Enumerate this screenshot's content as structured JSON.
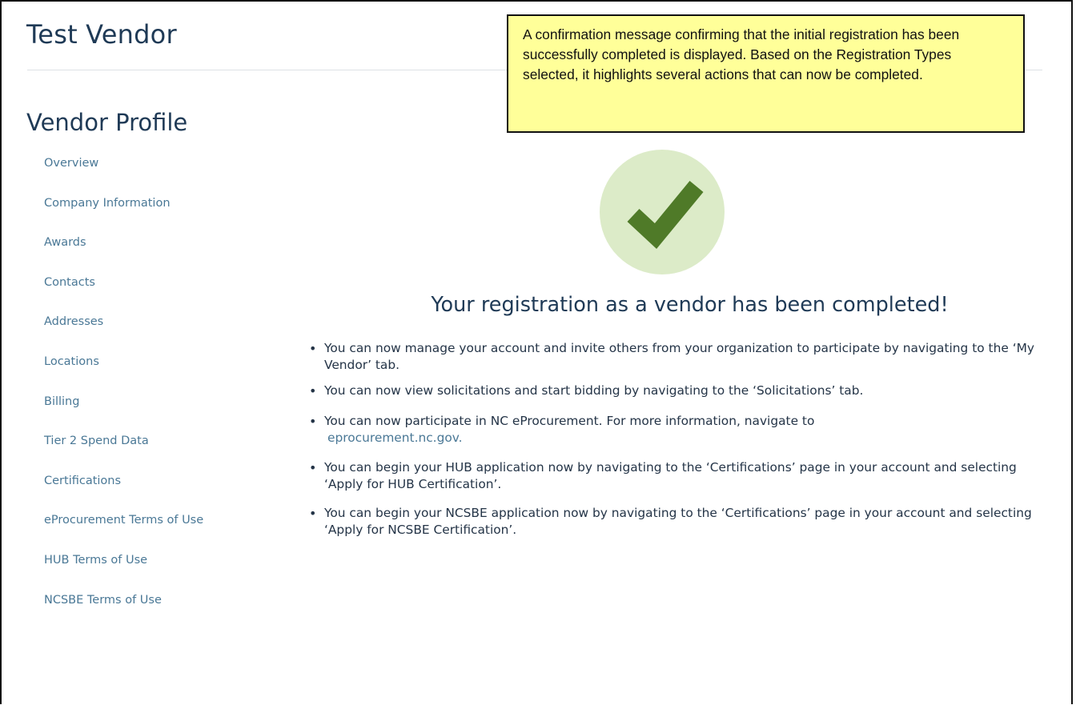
{
  "header": {
    "vendor_name": "Test Vendor"
  },
  "sidebar": {
    "heading": "Vendor Profile",
    "items": [
      {
        "label": "Overview"
      },
      {
        "label": "Company Information"
      },
      {
        "label": "Awards"
      },
      {
        "label": "Contacts"
      },
      {
        "label": "Addresses"
      },
      {
        "label": "Locations"
      },
      {
        "label": "Billing"
      },
      {
        "label": "Tier 2 Spend Data"
      },
      {
        "label": "Certifications"
      },
      {
        "label": "eProcurement Terms of Use"
      },
      {
        "label": "HUB Terms of Use"
      },
      {
        "label": "NCSBE Terms of Use"
      }
    ]
  },
  "callout": {
    "text": "A confirmation message confirming that the initial registration has been successfully completed is displayed. Based on the Registration Types selected, it highlights several actions that can now be completed."
  },
  "confirmation": {
    "icon": "checkmark-icon",
    "title": "Your registration as a vendor has been completed!",
    "bullets": [
      {
        "text": "You can now manage your account and invite others from your organization to participate by navigating to the ‘My Vendor’ tab."
      },
      {
        "text": "You can now view solicitations and start bidding by navigating to the ‘Solicitations’ tab."
      },
      {
        "text": "You can now participate in NC eProcurement. For more information, navigate to",
        "link": "eprocurement.nc.gov."
      },
      {
        "text": "You can begin your HUB application now by navigating to the ‘Certifications’ page in your account and selecting ‘Apply for HUB Certification’."
      },
      {
        "text": "You can begin your NCSBE application now by navigating to the ‘Certifications’ page in your account and selecting ‘Apply for NCSBE Certification’."
      }
    ],
    "bullet_glyph": "•"
  },
  "colors": {
    "check_dark": "#4f7a28",
    "check_bg": "#dcebc8",
    "link": "#4a7896",
    "callout_bg": "#ffff99"
  }
}
